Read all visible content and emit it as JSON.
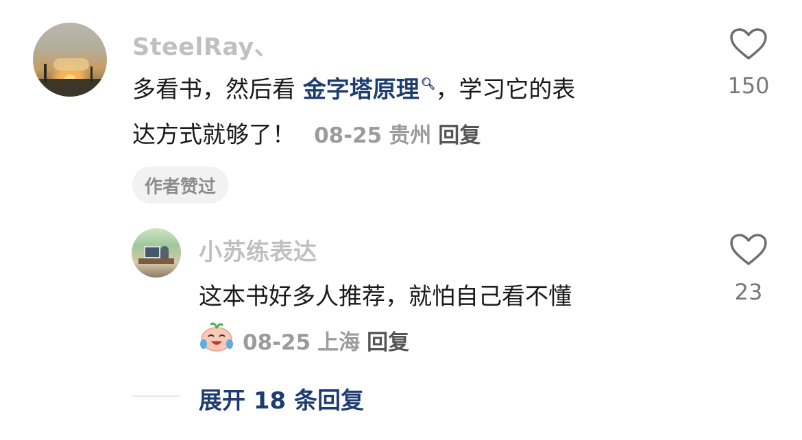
{
  "comment": {
    "username": "SteelRay、",
    "text_line1_a": "多看书，然后看",
    "text_link": "金字塔原理",
    "text_line1_b": "，学习它的表",
    "text_line2": "达方式就够了！",
    "date": "08-25",
    "location": "贵州",
    "reply_label": "回复",
    "badge": "作者赞过",
    "likes": "150"
  },
  "reply": {
    "username": "小苏练表达",
    "text": "这本书好多人推荐，就怕自己看不懂",
    "date": "08-25",
    "location": "上海",
    "reply_label": "回复",
    "likes": "23"
  },
  "expand": {
    "label": "展开 18 条回复"
  },
  "icons": {
    "like": "heart-outline-icon",
    "search": "search-icon",
    "emoji": "laughing-crying-emoji-icon"
  }
}
